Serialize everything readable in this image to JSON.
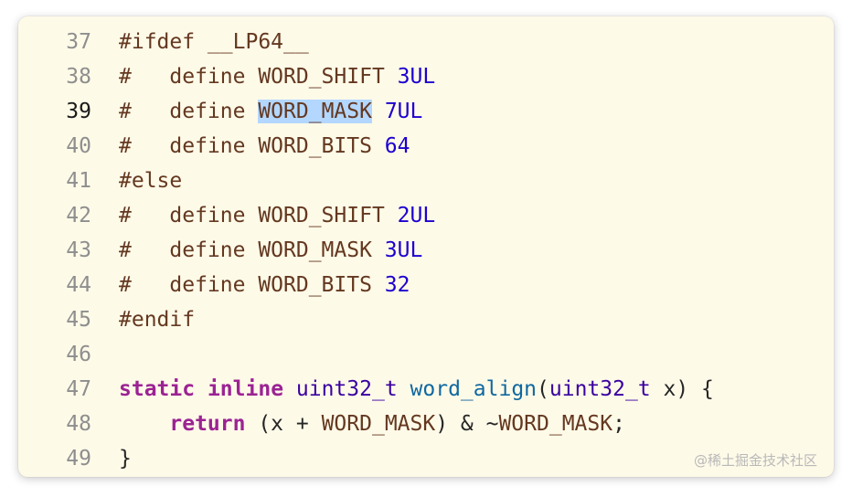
{
  "editor": {
    "lines": [
      {
        "no": "37",
        "tokens": [
          {
            "t": "#ifdef __LP64__",
            "c": "pp"
          }
        ]
      },
      {
        "no": "38",
        "tokens": [
          {
            "t": "#   define WORD_SHIFT ",
            "c": "pp"
          },
          {
            "t": "3UL",
            "c": "num"
          }
        ]
      },
      {
        "no": "39",
        "current": true,
        "tokens": [
          {
            "t": "#   define ",
            "c": "pp"
          },
          {
            "t": "WORD_MASK",
            "c": "pp",
            "sel": true
          },
          {
            "t": " ",
            "c": "pp"
          },
          {
            "t": "7UL",
            "c": "num"
          }
        ]
      },
      {
        "no": "40",
        "tokens": [
          {
            "t": "#   define WORD_BITS ",
            "c": "pp"
          },
          {
            "t": "64",
            "c": "num"
          }
        ]
      },
      {
        "no": "41",
        "tokens": [
          {
            "t": "#else",
            "c": "pp"
          }
        ]
      },
      {
        "no": "42",
        "tokens": [
          {
            "t": "#   define WORD_SHIFT ",
            "c": "pp"
          },
          {
            "t": "2UL",
            "c": "num"
          }
        ]
      },
      {
        "no": "43",
        "tokens": [
          {
            "t": "#   define WORD_MASK ",
            "c": "pp"
          },
          {
            "t": "3UL",
            "c": "num"
          }
        ]
      },
      {
        "no": "44",
        "tokens": [
          {
            "t": "#   define WORD_BITS ",
            "c": "pp"
          },
          {
            "t": "32",
            "c": "num"
          }
        ]
      },
      {
        "no": "45",
        "tokens": [
          {
            "t": "#endif",
            "c": "pp"
          }
        ]
      },
      {
        "no": "46",
        "tokens": []
      },
      {
        "no": "47",
        "tokens": [
          {
            "t": "static",
            "c": "kw"
          },
          {
            "t": " ",
            "c": "plain"
          },
          {
            "t": "inline",
            "c": "kw"
          },
          {
            "t": " ",
            "c": "plain"
          },
          {
            "t": "uint32_t",
            "c": "type"
          },
          {
            "t": " ",
            "c": "plain"
          },
          {
            "t": "word_align",
            "c": "fn"
          },
          {
            "t": "(",
            "c": "plain"
          },
          {
            "t": "uint32_t",
            "c": "type"
          },
          {
            "t": " x) {",
            "c": "plain"
          }
        ]
      },
      {
        "no": "48",
        "tokens": [
          {
            "t": "    ",
            "c": "plain"
          },
          {
            "t": "return",
            "c": "kw"
          },
          {
            "t": " (x + ",
            "c": "plain"
          },
          {
            "t": "WORD_MASK",
            "c": "pp"
          },
          {
            "t": ") & ~",
            "c": "plain"
          },
          {
            "t": "WORD_MASK",
            "c": "pp"
          },
          {
            "t": ";",
            "c": "plain"
          }
        ]
      },
      {
        "no": "49",
        "tokens": [
          {
            "t": "}",
            "c": "plain"
          }
        ]
      }
    ]
  },
  "watermark": "@稀土掘金技术社区",
  "colors": {
    "background": "#fefae8",
    "preprocessor": "#643820",
    "number": "#1c00cf",
    "keyword": "#9b2393",
    "type": "#3900a0",
    "function": "#0f68a0",
    "selection": "#b3d7ff"
  }
}
